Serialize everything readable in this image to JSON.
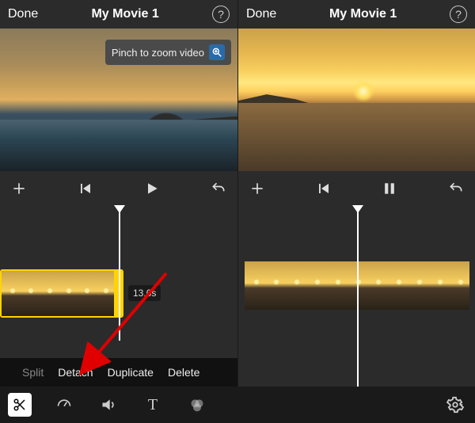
{
  "left": {
    "done": "Done",
    "title": "My Movie 1",
    "tooltip": "Pinch to zoom video",
    "clip_duration": "13.6s",
    "actions": {
      "split": "Split",
      "detach": "Detach",
      "duplicate": "Duplicate",
      "delete": "Delete"
    }
  },
  "right": {
    "done": "Done",
    "title": "My Movie 1"
  }
}
